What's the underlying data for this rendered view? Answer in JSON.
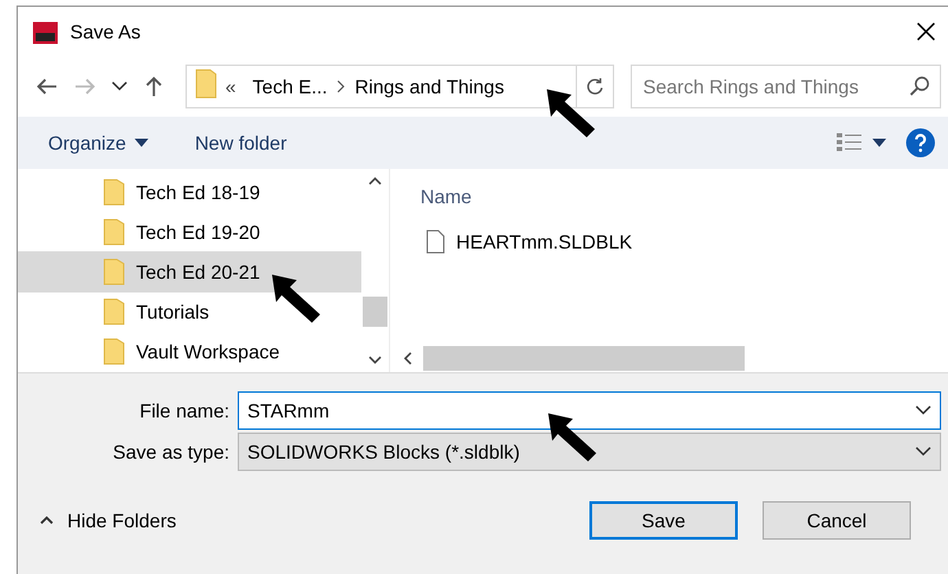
{
  "window": {
    "title": "Save As"
  },
  "address": {
    "overflow": "«",
    "crumbs": [
      "Tech E...",
      "Rings and Things"
    ]
  },
  "search": {
    "placeholder": "Search Rings and Things"
  },
  "toolbar": {
    "organize": "Organize",
    "new_folder": "New folder"
  },
  "folders": [
    {
      "label": "Tech Ed 18-19",
      "selected": false
    },
    {
      "label": "Tech Ed 19-20",
      "selected": false
    },
    {
      "label": "Tech Ed 20-21",
      "selected": true
    },
    {
      "label": "Tutorials",
      "selected": false
    },
    {
      "label": "Vault Workspace",
      "selected": false
    }
  ],
  "file_list": {
    "column": "Name",
    "files": [
      "HEARTmm.SLDBLK"
    ]
  },
  "file_name": {
    "label": "File name:",
    "value": "STARmm"
  },
  "save_type": {
    "label": "Save as type:",
    "value": "SOLIDWORKS Blocks (*.sldblk)"
  },
  "hide_folders": "Hide Folders",
  "buttons": [
    "Save",
    "Cancel"
  ]
}
